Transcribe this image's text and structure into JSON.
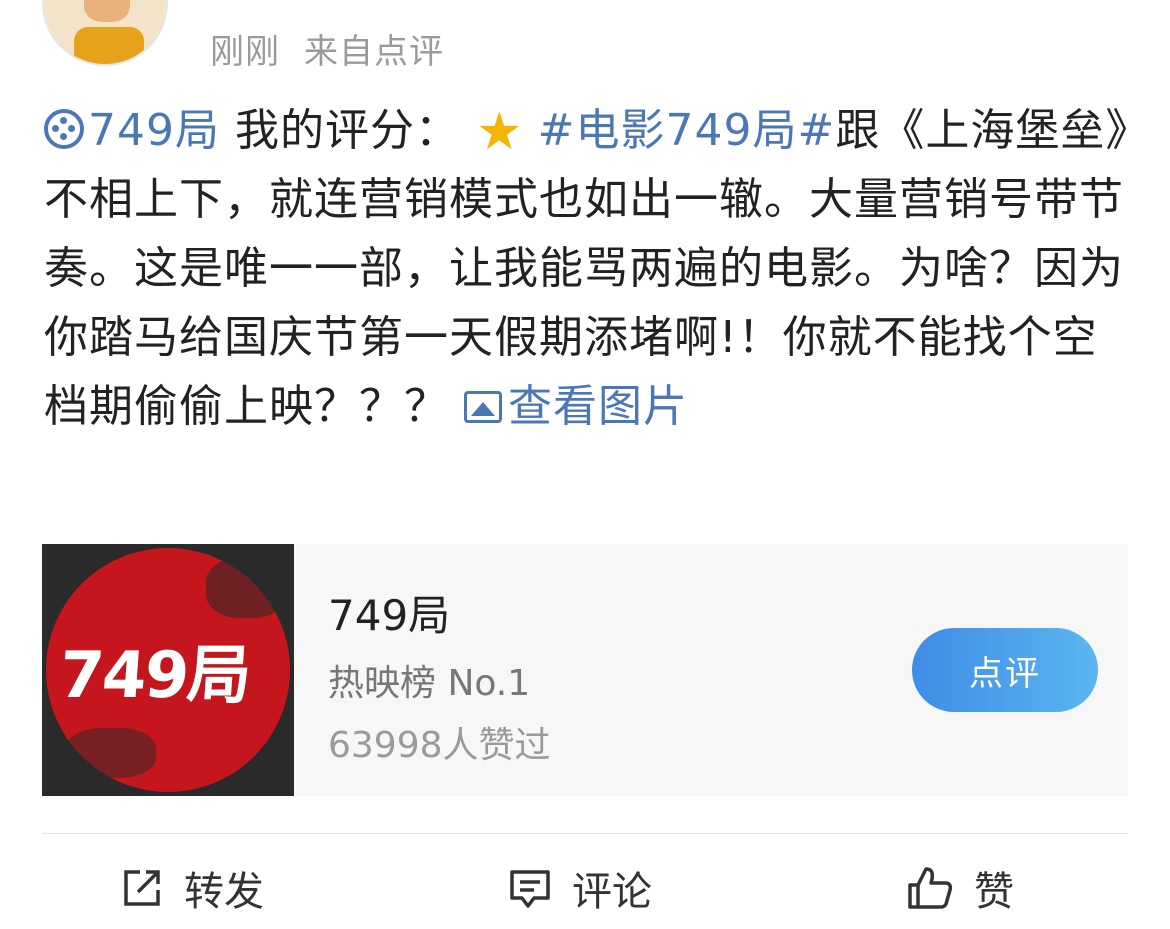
{
  "header": {
    "timestamp": "刚刚",
    "source": "来自点评"
  },
  "post": {
    "film_link": "749局",
    "rating_label": "我的评分：",
    "rating_stars": 0.5,
    "hashtag": "#电影749局#",
    "body": "跟《上海堡垒》不相上下，就连营销模式也如出一辙。大量营销号带节奏。这是唯一一部，让我能骂两遍的电影。为啥？因为你踏马给国庆节第一天假期添堵啊!！你就不能找个空档期偷偷上映？？？",
    "view_images": "查看图片"
  },
  "card": {
    "poster_text": "749局",
    "title": "749局",
    "subtitle": "热映榜 No.1",
    "likes": "63998人赞过",
    "button": "点评",
    "accent_color": "#c4161c"
  },
  "actions": {
    "repost": "转发",
    "comment": "评论",
    "like": "赞"
  },
  "colors": {
    "link": "#4a78b6",
    "button_gradient_start": "#3f8ce6",
    "button_gradient_end": "#5ab6f0"
  }
}
